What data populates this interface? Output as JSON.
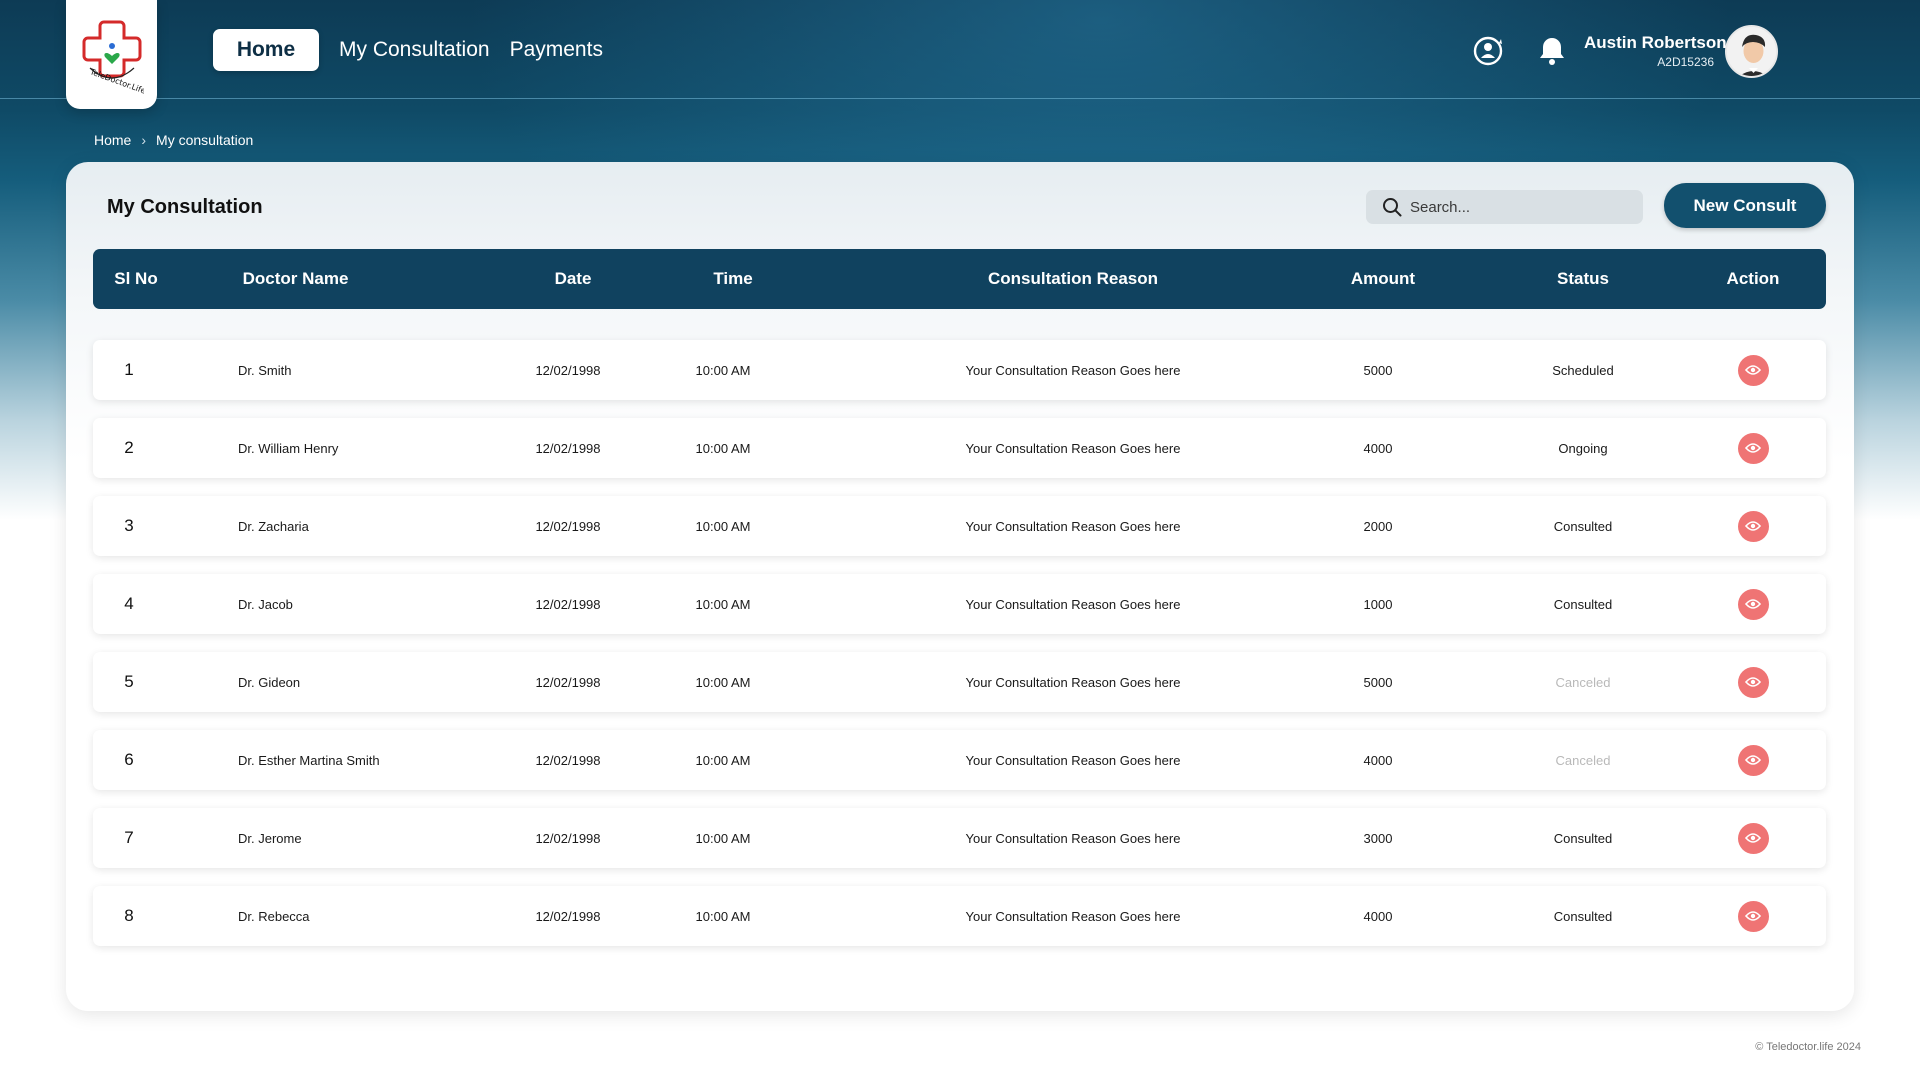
{
  "nav": {
    "home": "Home",
    "my_consultation": "My Consultation",
    "payments": "Payments"
  },
  "header": {
    "icons": [
      "help-refresh-icon",
      "bell-icon"
    ],
    "user_name": "Austin Robertson",
    "user_id": "A2D15236"
  },
  "logo": {
    "text": "TeleDoctor.Life"
  },
  "breadcrumb": {
    "home": "Home",
    "current": "My consultation"
  },
  "panel": {
    "title": "My Consultation",
    "search_placeholder": "Search...",
    "new_consult": "New Consult"
  },
  "table": {
    "headers": [
      "Sl No",
      "Doctor Name",
      "Date",
      "Time",
      "Consultation Reason",
      "Amount",
      "Status",
      "Action"
    ],
    "rows": [
      {
        "sl": "1",
        "doctor": "Dr. Smith",
        "date": "12/02/1998",
        "time": "10:00 AM",
        "reason": "Your Consultation Reason Goes here",
        "amount": "5000",
        "status": "Scheduled"
      },
      {
        "sl": "2",
        "doctor": "Dr. William Henry",
        "date": "12/02/1998",
        "time": "10:00 AM",
        "reason": "Your Consultation Reason Goes here",
        "amount": "4000",
        "status": "Ongoing"
      },
      {
        "sl": "3",
        "doctor": "Dr. Zacharia",
        "date": "12/02/1998",
        "time": "10:00 AM",
        "reason": "Your Consultation Reason Goes here",
        "amount": "2000",
        "status": "Consulted"
      },
      {
        "sl": "4",
        "doctor": "Dr. Jacob",
        "date": "12/02/1998",
        "time": "10:00 AM",
        "reason": "Your Consultation Reason Goes here",
        "amount": "1000",
        "status": "Consulted"
      },
      {
        "sl": "5",
        "doctor": "Dr. Gideon",
        "date": "12/02/1998",
        "time": "10:00 AM",
        "reason": "Your Consultation Reason Goes here",
        "amount": "5000",
        "status": "Canceled"
      },
      {
        "sl": "6",
        "doctor": "Dr. Esther Martina Smith",
        "date": "12/02/1998",
        "time": "10:00 AM",
        "reason": "Your Consultation Reason Goes here",
        "amount": "4000",
        "status": "Canceled"
      },
      {
        "sl": "7",
        "doctor": "Dr. Jerome",
        "date": "12/02/1998",
        "time": "10:00 AM",
        "reason": "Your Consultation Reason Goes here",
        "amount": "3000",
        "status": "Consulted"
      },
      {
        "sl": "8",
        "doctor": "Dr. Rebecca",
        "date": "12/02/1998",
        "time": "10:00 AM",
        "reason": "Your Consultation Reason Goes here",
        "amount": "4000",
        "status": "Consulted"
      }
    ],
    "action_icon": "eye-icon"
  },
  "colors": {
    "header_bg": "#0d3b55",
    "table_header": "#10425f",
    "button": "#12506e",
    "action": "#ef7474",
    "canceled_text": "#b9b9b9"
  },
  "footer": {
    "copyright": "© Teledoctor.life 2024"
  }
}
